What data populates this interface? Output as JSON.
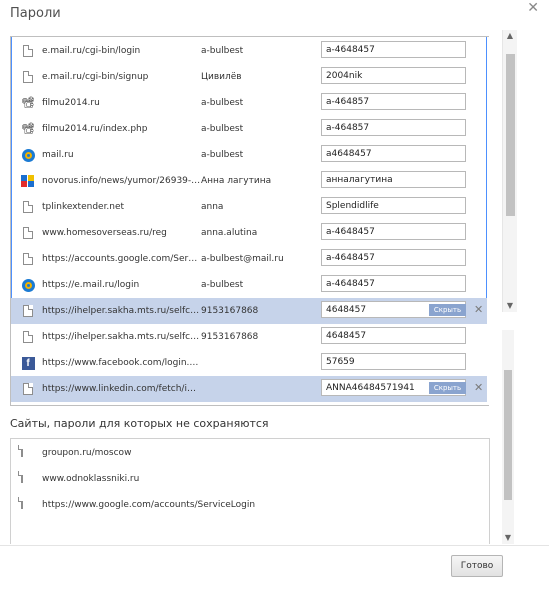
{
  "dialog": {
    "title": "Пароли",
    "close_glyph": "×"
  },
  "saved_passwords": [
    {
      "icon": "document-icon",
      "site": "e.mail.ru/cgi-bin/login",
      "user": "a-bulbest",
      "password": "a-4648457",
      "selected": false
    },
    {
      "icon": "document-icon",
      "site": "e.mail.ru/cgi-bin/signup",
      "user": "Цивилёв",
      "password": "2004nik",
      "selected": false
    },
    {
      "icon": "film-camera-icon",
      "site": "filmu2014.ru",
      "user": "a-bulbest",
      "password": "a-464857",
      "selected": false
    },
    {
      "icon": "film-camera-icon",
      "site": "filmu2014.ru/index.php",
      "user": "a-bulbest",
      "password": "a-464857",
      "selected": false
    },
    {
      "icon": "mail-ru-icon",
      "site": "mail.ru",
      "user": "a-bulbest",
      "password": "a4648457",
      "selected": false
    },
    {
      "icon": "novorus-icon",
      "site": "novorus.info/news/yumor/26939-a...",
      "user": "Анна лагутина",
      "password": "анналагутина",
      "selected": false
    },
    {
      "icon": "document-icon",
      "site": "tplinkextender.net",
      "user": "anna",
      "password": "Splendidlife",
      "selected": false
    },
    {
      "icon": "document-icon",
      "site": "www.homesoverseas.ru/reg",
      "user": "anna.alutina",
      "password": "a-4648457",
      "selected": false
    },
    {
      "icon": "document-icon",
      "site": "https://accounts.google.com/Servi...",
      "user": "a-bulbest@mail.ru",
      "password": "a-4648457",
      "selected": false
    },
    {
      "icon": "mail-ru-icon",
      "site": "https://e.mail.ru/login",
      "user": "a-bulbest",
      "password": "a-4648457",
      "selected": false
    },
    {
      "icon": "document-icon",
      "site": "https://ihelper.sakha.mts.ru/selfcar...",
      "user": "9153167868",
      "password": "4648457",
      "selected": true,
      "hide_label": "Скрыть"
    },
    {
      "icon": "document-icon",
      "site": "https://ihelper.sakha.mts.ru/selfcar...",
      "user": "9153167868",
      "password": "4648457",
      "selected": false
    },
    {
      "icon": "facebook-icon",
      "site": "https://www.facebook.com/login.p...",
      "user": "",
      "password": "57659",
      "selected": false
    },
    {
      "icon": "document-icon",
      "site": "https://www.linkedin.com/fetch/im...",
      "user": "",
      "password": "ANNA46484571941",
      "selected": true,
      "hide_label": "Скрыть"
    }
  ],
  "never_saved": {
    "title": "Сайты, пароли для которых не сохраняются",
    "sites": [
      "groupon.ru/moscow",
      "www.odnoklassniki.ru",
      "https://www.google.com/accounts/ServiceLogin"
    ]
  },
  "footer": {
    "done_label": "Готово"
  },
  "colors": {
    "selection": "#c6d3ea",
    "hide_button": "#8aa4cf",
    "focus_border": "#4d90fe"
  },
  "glyphs": {
    "delete": "✕",
    "scroll_up": "▲",
    "scroll_down": "▼",
    "facebook": "f",
    "film": "🎥"
  }
}
